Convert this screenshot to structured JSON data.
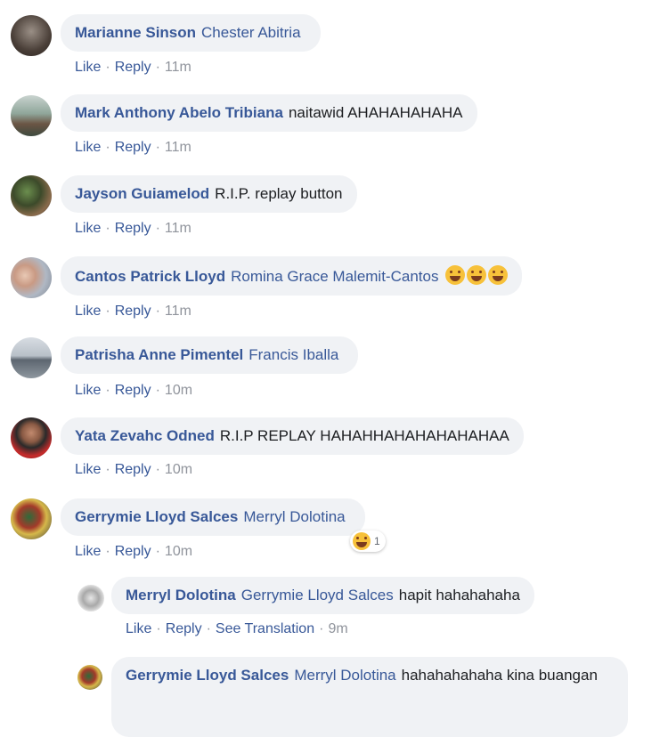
{
  "actions": {
    "like": "Like",
    "reply": "Reply",
    "see_translation": "See Translation"
  },
  "reaction_count": "1",
  "comments": [
    {
      "author": "Marianne Sinson",
      "mention": "Chester Abitria",
      "text": "",
      "time": "11m"
    },
    {
      "author": "Mark Anthony Abelo Tribiana",
      "mention": "",
      "text": "naitawid AHAHAHAHAHA",
      "time": "11m"
    },
    {
      "author": "Jayson Guiamelod",
      "mention": "",
      "text": "R.I.P. replay button",
      "time": "11m"
    },
    {
      "author": "Cantos Patrick Lloyd",
      "mention": "Romina Grace Malemit-Cantos",
      "text": "",
      "time": "11m"
    },
    {
      "author": "Patrisha Anne Pimentel",
      "mention": "Francis Iballa",
      "text": "",
      "time": "10m"
    },
    {
      "author": "Yata Zevahc Odned",
      "mention": "",
      "text": "R.I.P REPLAY HAHAHHAHAHAHAHAHAA",
      "time": "10m"
    },
    {
      "author": "Gerrymie Lloyd Salces",
      "mention": "Merryl Dolotina",
      "text": "",
      "time": "10m"
    },
    {
      "author": "Merryl Dolotina",
      "mention": "Gerrymie Lloyd Salces",
      "text": "hapit hahahahaha",
      "time": "9m"
    },
    {
      "author": "Gerrymie Lloyd Salces",
      "mention": "Merryl Dolotina",
      "text": "hahahahahaha kina buangan",
      "time": ""
    }
  ],
  "colors": {
    "link": "#385898",
    "bubble": "#f0f2f5",
    "meta": "#90949c"
  }
}
